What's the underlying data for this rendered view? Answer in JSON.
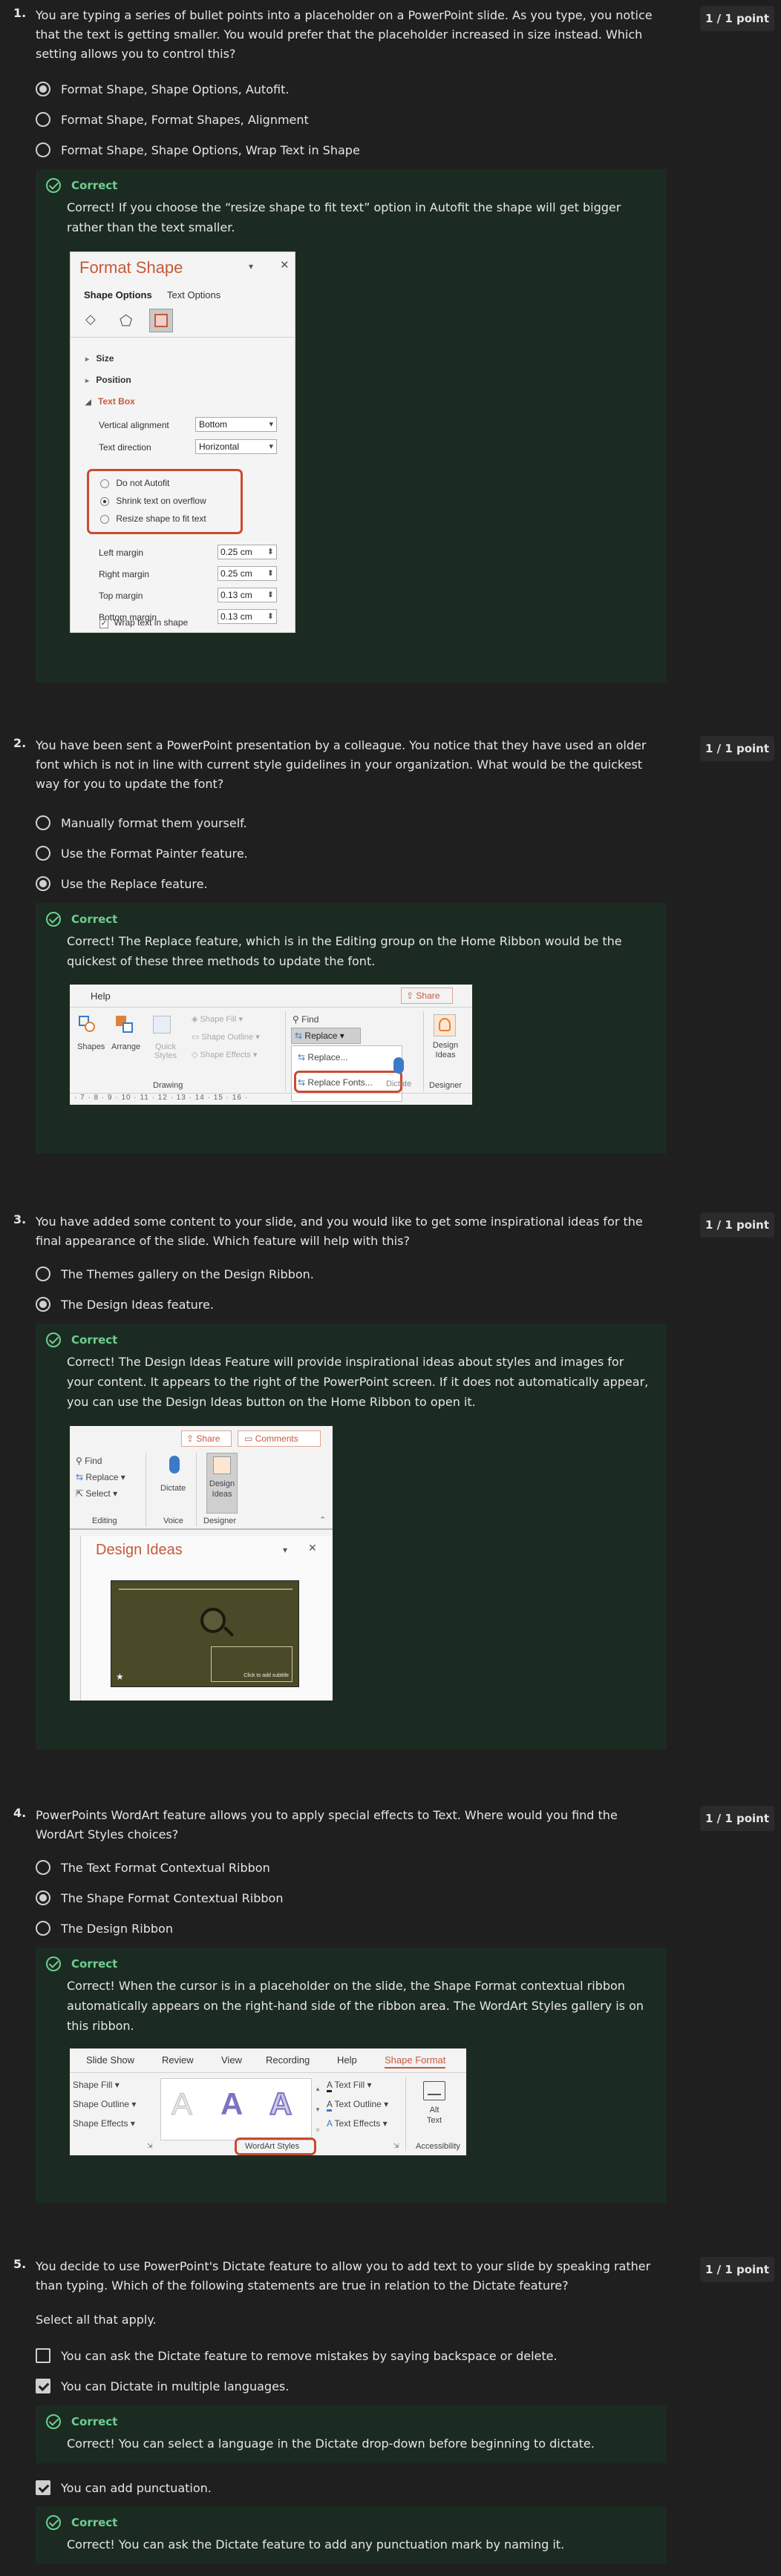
{
  "q1": {
    "number": "1.",
    "text": "You are typing a series of bullet points into a placeholder on a PowerPoint slide. As you type, you notice that the text is getting smaller. You would prefer that the placeholder increased in size instead. Which setting allows you to control this?",
    "points": "1 / 1 point",
    "options": [
      "Format Shape, Shape Options, Autofit.",
      "Format Shape, Format Shapes, Alignment",
      "Format Shape, Shape Options, Wrap Text in Shape"
    ],
    "feedback_title": "Correct",
    "feedback_text": "Correct! If you choose the “resize shape to fit text” option in Autofit the shape will get bigger rather than the text smaller.",
    "panel": {
      "title": "Format Shape",
      "tab1": "Shape Options",
      "tab2": "Text Options",
      "sections": [
        "Size",
        "Position",
        "Text Box"
      ],
      "valign_label": "Vertical alignment",
      "valign_value": "Bottom",
      "tdir_label": "Text direction",
      "tdir_value": "Horizontal",
      "autofit": [
        "Do not Autofit",
        "Shrink text on overflow",
        "Resize shape to fit text"
      ],
      "margins": [
        {
          "label": "Left margin",
          "value": "0.25 cm"
        },
        {
          "label": "Right margin",
          "value": "0.25 cm"
        },
        {
          "label": "Top margin",
          "value": "0.13 cm"
        },
        {
          "label": "Bottom margin",
          "value": "0.13 cm"
        }
      ],
      "wrap": "Wrap text in shape"
    }
  },
  "q2": {
    "number": "2.",
    "text": "You have been sent a PowerPoint presentation by a colleague. You notice that they have used an older font which is not in line with current style guidelines in your organization. What would be the quickest way for you to update the font?",
    "points": "1 / 1 point",
    "options": [
      "Manually format them yourself.",
      "Use the Format Painter feature.",
      "Use the Replace feature."
    ],
    "feedback_title": "Correct",
    "feedback_text": "Correct! The Replace feature, which is in the Editing group on the Home Ribbon would be the quickest of these three methods to update the font.",
    "ribbon": {
      "help": "Help",
      "share": "Share",
      "shapes": "Shapes",
      "arrange": "Arrange",
      "quick_styles": "Quick Styles",
      "shape_fill": "Shape Fill",
      "shape_outline": "Shape Outline",
      "shape_effects": "Shape Effects",
      "drawing": "Drawing",
      "find": "Find",
      "replace": "Replace",
      "replace_item": "Replace...",
      "replace_fonts": "Replace Fonts...",
      "dictate": "Dictate",
      "design_ideas": "Design Ideas",
      "designer": "Designer",
      "ruler": "· 7 · 8 · 9 · 10 · 11 · 12 · 13 · 14 · 15 · 16 ·"
    }
  },
  "q3": {
    "number": "3.",
    "text": "You have added some content to your slide, and you would like to get some inspirational ideas for the final appearance of the slide. Which feature will help with this?",
    "points": "1 / 1 point",
    "options": [
      "The Themes gallery on the Design Ribbon.",
      "The Design Ideas feature."
    ],
    "feedback_title": "Correct",
    "feedback_text": "Correct! The Design Ideas Feature will provide inspirational ideas about styles and images for your content. It appears to the right of the PowerPoint screen. If it does not automatically appear, you can use the Design Ideas button on the Home Ribbon to open it.",
    "panel": {
      "share": "Share",
      "comments": "Comments",
      "find": "Find",
      "replace": "Replace",
      "select": "Select",
      "editing": "Editing",
      "dictate": "Dictate",
      "voice": "Voice",
      "design_ideas_btn": "Design Ideas",
      "designer": "Designer",
      "pane_title": "Design Ideas",
      "thumb_caption": "Click to add subtitle"
    }
  },
  "q4": {
    "number": "4.",
    "text": "PowerPoints WordArt feature allows you to apply special effects to Text. Where would you find the WordArt Styles choices?",
    "points": "1 / 1 point",
    "options": [
      "The Text Format Contextual Ribbon",
      "The Shape Format Contextual Ribbon",
      "The Design Ribbon"
    ],
    "feedback_title": "Correct",
    "feedback_text": "Correct! When the cursor is in a placeholder on the slide, the Shape Format contextual ribbon automatically appears on the right-hand side of the ribbon area. The WordArt Styles gallery is on this ribbon.",
    "ribbon": {
      "tabs": [
        "Slide Show",
        "Review",
        "View",
        "Recording",
        "Help",
        "Shape Format"
      ],
      "shape_fill": "Shape Fill",
      "shape_outline": "Shape Outline",
      "shape_effects": "Shape Effects",
      "text_fill": "Text Fill",
      "text_outline": "Text Outline",
      "text_effects": "Text Effects",
      "wordart_styles": "WordArt Styles",
      "alt_text": "Alt Text",
      "accessibility": "Accessibility",
      "glyph": "A"
    }
  },
  "q5": {
    "number": "5.",
    "text": "You decide to use PowerPoint's Dictate feature to allow you to add text to your slide by speaking rather than typing. Which of the following statements are true in relation to the Dictate feature?",
    "points": "1 / 1 point",
    "instruction": "Select all that apply.",
    "options": [
      "You can ask the Dictate feature to remove mistakes by saying backspace or delete.",
      "You can Dictate in multiple languages.",
      "You can add punctuation."
    ],
    "feedback": [
      {
        "title": "Correct",
        "text": "Correct! You can select a language in the Dictate drop-down before beginning to dictate."
      },
      {
        "title": "Correct",
        "text": "Correct! You can ask the Dictate feature to add any punctuation mark by naming it."
      }
    ]
  },
  "colors": {
    "background": "#1f1f1f",
    "feedback_bg": "#1c2b22",
    "correct_green": "#6ccf8e",
    "highlight_red": "#c84b2f",
    "ppt_orange": "#c55a3a"
  }
}
